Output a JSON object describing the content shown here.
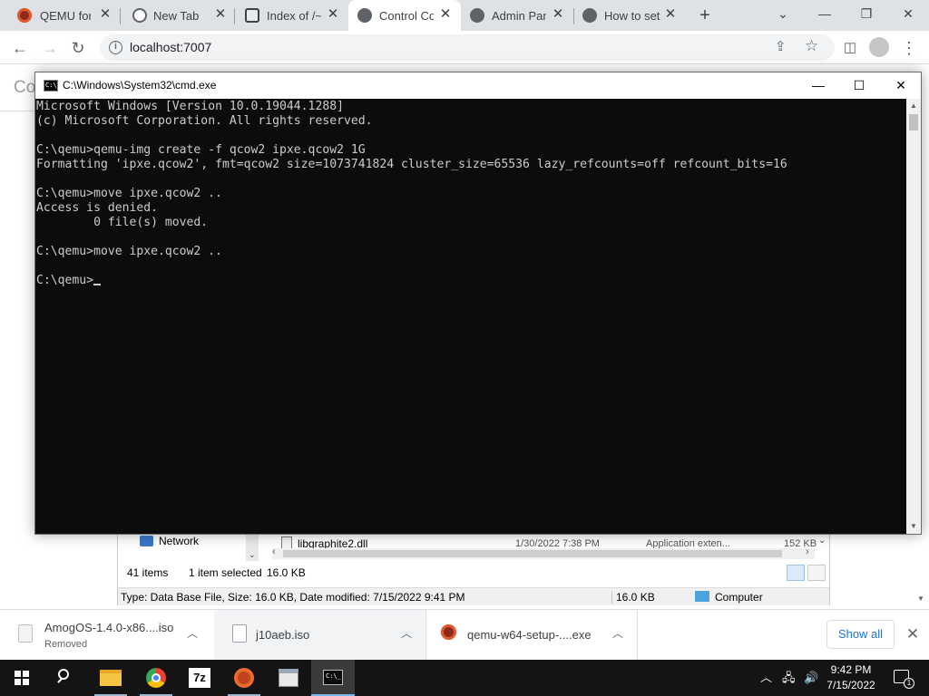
{
  "browser": {
    "tabs": [
      {
        "title": "QEMU for W",
        "icon": "qemu-icon",
        "active": false
      },
      {
        "title": "New Tab",
        "icon": "chrome-icon",
        "active": false
      },
      {
        "title": "Index of /~",
        "icon": "index-icon",
        "active": false
      },
      {
        "title": "Control Co",
        "icon": "globe-icon",
        "active": true
      },
      {
        "title": "Admin Pan",
        "icon": "globe-icon",
        "active": false
      },
      {
        "title": "How to set",
        "icon": "globe-icon",
        "active": false
      }
    ],
    "url": "localhost:7007"
  },
  "webpage": {
    "partial_heading": "Co"
  },
  "explorer": {
    "nav_item": "Network",
    "file_name": "libgraphite2.dll",
    "file_date": "1/30/2022 7:38 PM",
    "file_type": "Application exten...",
    "file_size": "152 KB",
    "item_count": "41 items",
    "selection": "1 item selected",
    "selection_size": "16.0 KB",
    "details": "Type: Data Base File, Size: 16.0 KB, Date modified: 7/15/2022 9:41 PM",
    "details_size": "16.0 KB",
    "location": "Computer"
  },
  "cmd": {
    "title": "C:\\Windows\\System32\\cmd.exe",
    "icon_label": "C:\\_",
    "output": "Microsoft Windows [Version 10.0.19044.1288]\n(c) Microsoft Corporation. All rights reserved.\n\nC:\\qemu>qemu-img create -f qcow2 ipxe.qcow2 1G\nFormatting 'ipxe.qcow2', fmt=qcow2 size=1073741824 cluster_size=65536 lazy_refcounts=off refcount_bits=16\n\nC:\\qemu>move ipxe.qcow2 ..\nAccess is denied.\n        0 file(s) moved.\n\nC:\\qemu>move ipxe.qcow2 ..\n\nC:\\qemu>"
  },
  "downloads": [
    {
      "name": "AmogOS-1.4.0-x86....iso",
      "status": "Removed"
    },
    {
      "name": "j10aeb.iso",
      "status": ""
    },
    {
      "name": "qemu-w64-setup-....exe",
      "status": ""
    }
  ],
  "downloads_show_all": "Show all",
  "taskbar": {
    "time": "9:42 PM",
    "date": "7/15/2022",
    "sevenzip_label": "7z",
    "notification_count": "1"
  },
  "colors": {
    "console_bg": "#0c0c0c",
    "console_text": "#cccccc",
    "chrome_accent": "#1a73e8",
    "taskbar_bg": "#141414"
  }
}
